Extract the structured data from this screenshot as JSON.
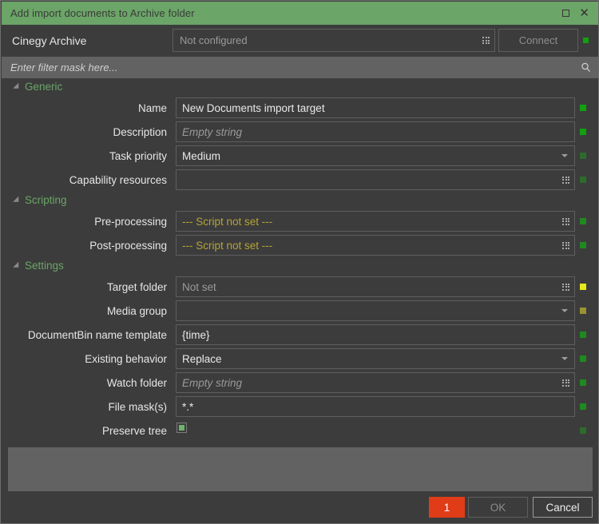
{
  "window": {
    "title": "Add import documents to Archive folder",
    "maximize_icon": "maximize-icon",
    "close_icon": "close-icon",
    "close_glyph": "✕"
  },
  "connection": {
    "label": "Cinegy Archive",
    "field_placeholder": "Not configured",
    "connect_label": "Connect",
    "status_color": "#10a010"
  },
  "filter": {
    "placeholder": "Enter filter mask here...",
    "value": "",
    "icon": "search-icon"
  },
  "sections": [
    {
      "key": "generic",
      "title": "Generic",
      "rows": [
        {
          "label": "Name",
          "value": "New Documents import target",
          "kind": "text",
          "placeholder": false,
          "status": "#10a010"
        },
        {
          "label": "Description",
          "value": "Empty string",
          "kind": "text",
          "placeholder": true,
          "status": "#10a010"
        },
        {
          "label": "Task priority",
          "value": "Medium",
          "kind": "dropdown",
          "placeholder": false,
          "status": "#2d6b2d"
        },
        {
          "label": "Capability resources",
          "value": "",
          "kind": "browse",
          "placeholder": false,
          "status": "#2d6b2d"
        }
      ]
    },
    {
      "key": "scripting",
      "title": "Scripting",
      "rows": [
        {
          "label": "Pre-processing",
          "value": "--- Script not set ---",
          "kind": "browse",
          "script": true,
          "status": "#1f8a1f"
        },
        {
          "label": "Post-processing",
          "value": "--- Script not set ---",
          "kind": "browse",
          "script": true,
          "status": "#1f8a1f"
        }
      ]
    },
    {
      "key": "settings",
      "title": "Settings",
      "rows": [
        {
          "label": "Target folder",
          "value": "Not set",
          "kind": "browse",
          "notset": true,
          "status": "#e8e81a"
        },
        {
          "label": "Media group",
          "value": "",
          "kind": "dropdown",
          "status": "#9a9430"
        },
        {
          "label": "DocumentBin name template",
          "value": "{time}",
          "kind": "text",
          "status": "#1f8a1f"
        },
        {
          "label": "Existing behavior",
          "value": "Replace",
          "kind": "dropdown",
          "status": "#1f8a1f"
        },
        {
          "label": "Watch folder",
          "value": "Empty string",
          "kind": "browse",
          "placeholder": true,
          "status": "#1f8a1f"
        },
        {
          "label": "File mask(s)",
          "value": "*.*",
          "kind": "text",
          "status": "#1f8a1f"
        },
        {
          "label": "Preserve tree",
          "value": "",
          "kind": "checkbox",
          "checked": true,
          "status": "#2d6b2d"
        }
      ]
    }
  ],
  "footer": {
    "error_count": "1",
    "ok_label": "OK",
    "cancel_label": "Cancel"
  }
}
